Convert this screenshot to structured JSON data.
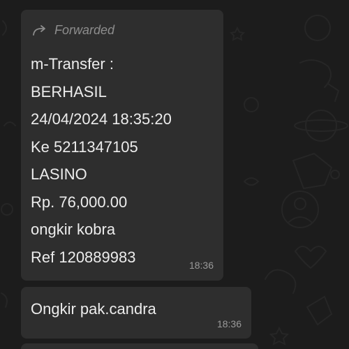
{
  "chat": {
    "messages": [
      {
        "forwarded_label": "Forwarded",
        "lines": [
          "m-Transfer :",
          "BERHASIL",
          "24/04/2024 18:35:20",
          "Ke 5211347105",
          "LASINO",
          "Rp. 76,000.00",
          "ongkir kobra",
          "Ref 120889983"
        ],
        "time": "18:36"
      },
      {
        "text": "Ongkir pak.candra",
        "time": "18:36"
      }
    ]
  },
  "icons": {
    "forwarded": "forward-arrow-icon"
  },
  "colors": {
    "background": "#1c1c1c",
    "bubble": "#2e2e2e",
    "text": "#ececec",
    "meta_text": "#8d8d8d"
  }
}
